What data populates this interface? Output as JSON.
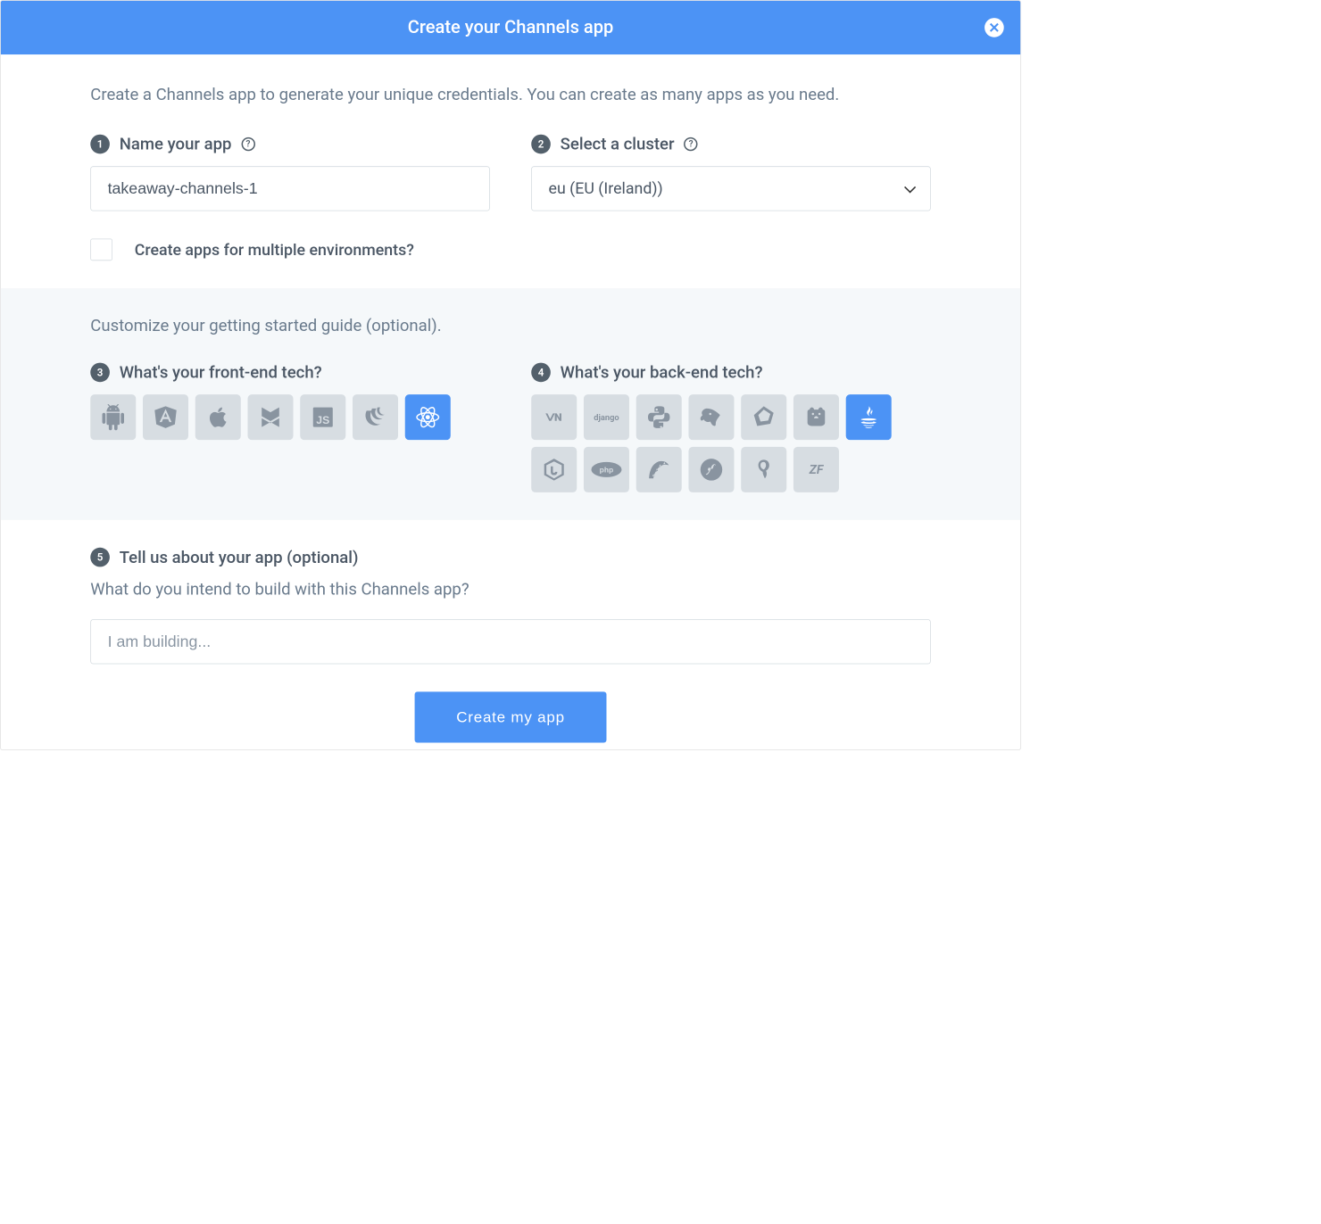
{
  "header": {
    "title": "Create your Channels app"
  },
  "intro": "Create a Channels app to generate your unique credentials. You can create as many apps as you need.",
  "step1": {
    "num": "1",
    "label": "Name your app",
    "value": "takeaway-channels-1"
  },
  "step2": {
    "num": "2",
    "label": "Select a cluster",
    "value": "eu (EU (Ireland))"
  },
  "multi_env_label": "Create apps for multiple environments?",
  "customize_text": "Customize your getting started guide (optional).",
  "step3": {
    "num": "3",
    "label": "What's your front-end tech?",
    "options": [
      "android",
      "angular",
      "apple",
      "backbone",
      "javascript",
      "jquery",
      "react"
    ],
    "selected": "react"
  },
  "step4": {
    "num": "4",
    "label": "What's your back-end tech?",
    "options": [
      "dotnet",
      "django",
      "python",
      "go",
      "crystal",
      "gopher",
      "java",
      "nodejs",
      "php",
      "rails",
      "symfony",
      "ycomb",
      "zend"
    ],
    "selected": "java"
  },
  "step5": {
    "num": "5",
    "label": "Tell us about your app (optional)",
    "subtext": "What do you intend to build with this Channels app?",
    "placeholder": "I am building..."
  },
  "submit_label": "Create my app"
}
